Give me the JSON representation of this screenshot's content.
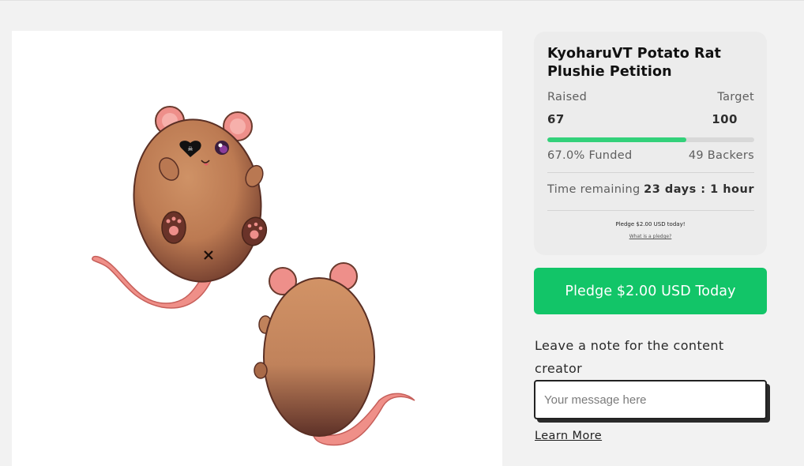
{
  "product": {
    "image_alt": "Potato rat plushie front and back illustration"
  },
  "campaign": {
    "title": "KyoharuVT Potato Rat Plushie Petition",
    "raised_label": "Raised",
    "target_label": "Target",
    "raised_value": "67",
    "target_value": "100",
    "progress_fraction": 0.67,
    "funded_text": "67.0% Funded",
    "backers_text": "49 Backers",
    "time_label": "Time remaining",
    "time_value": "23 days : 1 hour",
    "pledge_note": "Pledge $2.00 USD today!",
    "what_is_pledge": "What is a pledge?"
  },
  "pledge_button": {
    "label": "Pledge $2.00 USD Today"
  },
  "note": {
    "label": "Leave a note for the content creator",
    "placeholder": "Your message here",
    "value": ""
  },
  "learn_more": {
    "label": "Learn More"
  },
  "colors": {
    "accent": "#12c568",
    "progress": "#33d17a",
    "card_bg": "#ececec",
    "page_bg": "#f2f2f2"
  }
}
